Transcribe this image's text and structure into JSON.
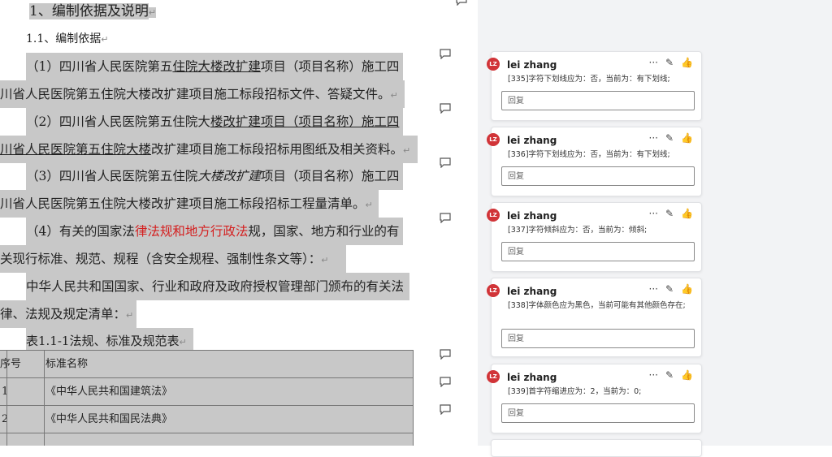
{
  "document": {
    "heading": "1、编制依据及说明",
    "subheading": "1.1、编制依据",
    "items": [
      {
        "a": "（1）四川省人民医院第五",
        "b": "住院大楼改扩建",
        "c": "项目（项目名称）施工四",
        "d": "川省人民医院第五住院大楼改扩建项目施工标段招标文件、答疑文件。"
      },
      {
        "a": "（2）四川省人民医院第五住院大",
        "b": "楼改扩建项目（项目名称）施工四",
        "d1": "川省人民医院第五住院大楼",
        "d2": "改扩建项目施工标段招标用图纸及相关资料。"
      },
      {
        "a": "（3）四川省人民医院第五住院",
        "b": "大楼改扩建",
        "c": "项目（项目名称）施工四",
        "d": "川省人民医院第五住院大楼改扩建项目施工标段招标工程量清单。"
      },
      {
        "a": "（4）有关的国家法",
        "b": "律法规和地方行政法",
        "c": "规，国家、地方和行业的有",
        "d": "关现行标准、规范、规程（含安全规程、强制性条文等）："
      }
    ],
    "para_line1": "中华人民共和国国家、行业和政府及政府授权管理部门颁布的有关法",
    "para_line2": "律、法规及规定清单：",
    "table_caption": "表1.1-1法规、标准及规范表",
    "table": {
      "headers": [
        "序号",
        "标准名称"
      ],
      "rows": [
        [
          "1",
          "《中华人民共和国建筑法》"
        ],
        [
          "2",
          "《中华人民共和国民法典》"
        ]
      ]
    },
    "para_mark": "↵"
  },
  "comments": [
    {
      "author": "lei zhang",
      "avatar": "LZ",
      "text": "[335]字符下划线应为：否，当前为：有下划线;",
      "reply_placeholder": "回复"
    },
    {
      "author": "lei zhang",
      "avatar": "LZ",
      "text": "[336]字符下划线应为：否，当前为：有下划线;",
      "reply_placeholder": "回复"
    },
    {
      "author": "lei zhang",
      "avatar": "LZ",
      "text": "[337]字符倾斜应为：否，当前为：倾斜;",
      "reply_placeholder": "回复"
    },
    {
      "author": "lei zhang",
      "avatar": "LZ",
      "text": "[338]字体颜色应为黑色，当前可能有其他颜色存在;",
      "reply_placeholder": "回复"
    },
    {
      "author": "lei zhang",
      "avatar": "LZ",
      "text": "[339]首字符缩进应为：2，当前为：0;",
      "reply_placeholder": "回复"
    }
  ],
  "icons": {
    "more": "···",
    "edit": "✎",
    "like": "👍"
  }
}
